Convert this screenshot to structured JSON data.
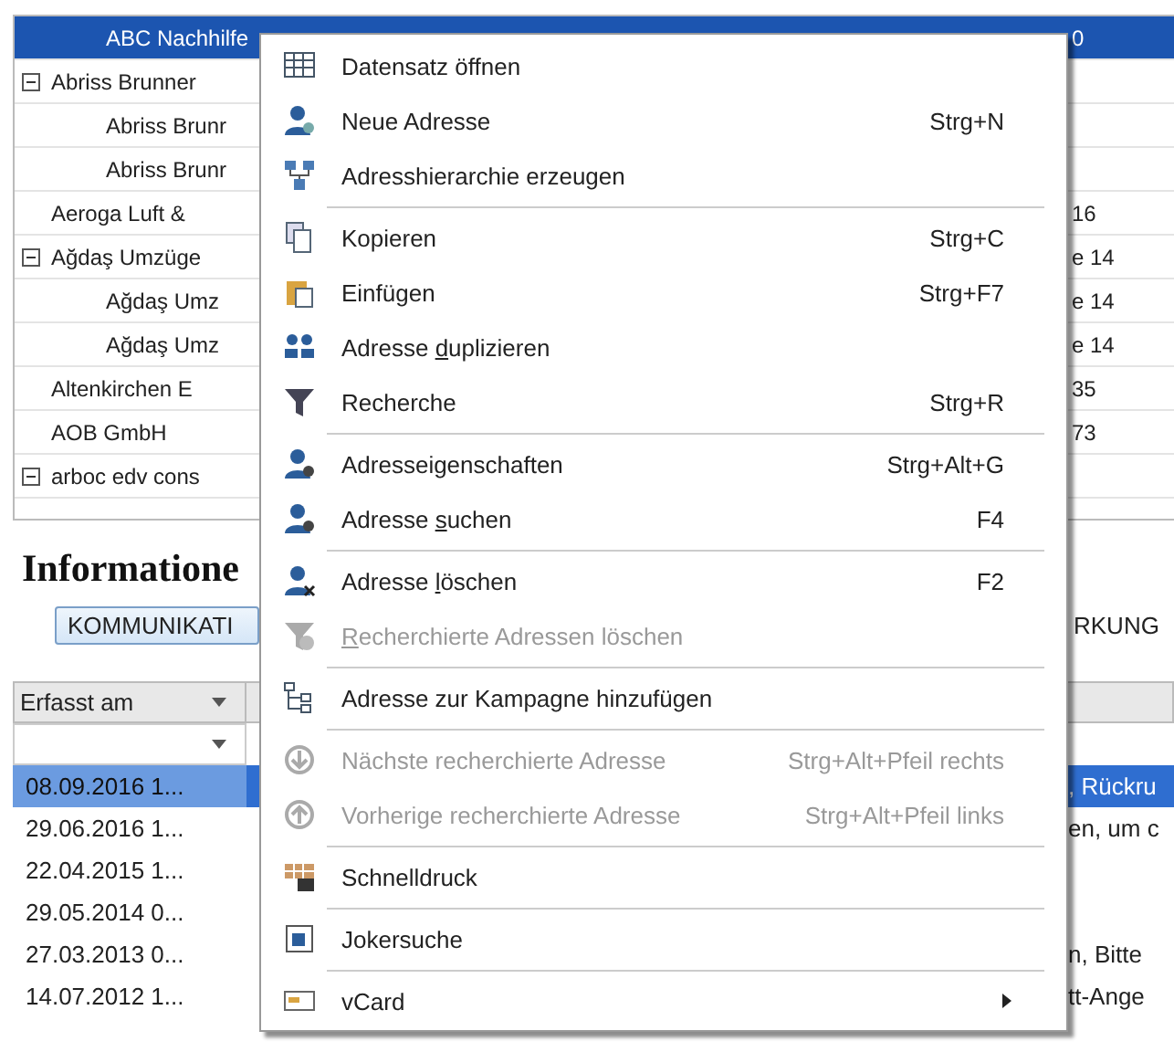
{
  "address_list": {
    "rows": [
      {
        "name": "ABC Nachhilfe",
        "expander": false,
        "indented": true,
        "selected": true,
        "column_2": "0"
      },
      {
        "name": "Abriss Brunner",
        "expander": true,
        "indented": false,
        "selected": false
      },
      {
        "name": "Abriss Brunr",
        "expander": false,
        "indented": true,
        "selected": false
      },
      {
        "name": "Abriss Brunr",
        "expander": false,
        "indented": true,
        "selected": false
      },
      {
        "name": "Aeroga Luft &",
        "expander": false,
        "indented": false,
        "selected": false,
        "column_2": "16"
      },
      {
        "name": "Ağdaş Umzüge",
        "expander": true,
        "indented": false,
        "selected": false,
        "column_2": "e 14"
      },
      {
        "name": "Ağdaş Umz",
        "expander": false,
        "indented": true,
        "selected": false,
        "column_2": "e 14"
      },
      {
        "name": "Ağdaş Umz",
        "expander": false,
        "indented": true,
        "selected": false,
        "column_2": "e 14"
      },
      {
        "name": "Altenkirchen E",
        "expander": false,
        "indented": false,
        "selected": false,
        "column_2": "35"
      },
      {
        "name": "AOB GmbH",
        "expander": false,
        "indented": false,
        "selected": false,
        "column_2": "73"
      },
      {
        "name": "arboc edv cons",
        "expander": true,
        "indented": false,
        "selected": false
      }
    ]
  },
  "information": {
    "title": "Informatione",
    "tabs": [
      {
        "label": "KOMMUNIKATI",
        "selected": true
      },
      {
        "label": "RKUNG",
        "selected": false
      }
    ],
    "grid": {
      "column_header": "Erfasst am",
      "rows": [
        {
          "date": "08.09.2016 1...",
          "column_2": ", Rückru",
          "selected": true
        },
        {
          "date": "29.06.2016 1...",
          "column_2": "en, um c",
          "selected": false
        },
        {
          "date": "22.04.2015 1...",
          "selected": false
        },
        {
          "date": "29.05.2014 0...",
          "selected": false
        },
        {
          "date": "27.03.2013 0...",
          "column_2": "n, Bitte",
          "selected": false
        },
        {
          "date": "14.07.2012 1...",
          "column_2": "tt-Ange",
          "selected": false
        }
      ]
    }
  },
  "context_menu": [
    {
      "kind": "item",
      "label": [
        {
          "text": "Datensatz öffnen",
          "underlined": false
        }
      ],
      "disabled": false,
      "submenu": false
    },
    {
      "kind": "item",
      "label": [
        {
          "text": "Neue Adresse",
          "underlined": false
        }
      ],
      "shortcut": "Strg+N",
      "disabled": false,
      "submenu": false
    },
    {
      "kind": "item",
      "label": [
        {
          "text": "Adresshierarchie erzeugen",
          "underlined": false
        }
      ],
      "disabled": false,
      "submenu": false
    },
    {
      "kind": "separator"
    },
    {
      "kind": "item",
      "label": [
        {
          "text": "Kopieren",
          "underlined": false
        }
      ],
      "shortcut": "Strg+C",
      "disabled": false,
      "submenu": false
    },
    {
      "kind": "item",
      "label": [
        {
          "text": "Einfügen",
          "underlined": false
        }
      ],
      "shortcut": "Strg+F7",
      "disabled": false,
      "submenu": false
    },
    {
      "kind": "item",
      "label": [
        {
          "text": "Adresse ",
          "underlined": false
        },
        {
          "text": "d",
          "underlined": true
        },
        {
          "text": "uplizieren",
          "underlined": false
        }
      ],
      "disabled": false,
      "submenu": false
    },
    {
      "kind": "item",
      "label": [
        {
          "text": "Recherche",
          "underlined": false
        }
      ],
      "shortcut": "Strg+R",
      "disabled": false,
      "submenu": false
    },
    {
      "kind": "separator"
    },
    {
      "kind": "item",
      "label": [
        {
          "text": "Adresseigenschaften",
          "underlined": false
        }
      ],
      "shortcut": "Strg+Alt+G",
      "disabled": false,
      "submenu": false
    },
    {
      "kind": "item",
      "label": [
        {
          "text": "Adresse ",
          "underlined": false
        },
        {
          "text": "s",
          "underlined": true
        },
        {
          "text": "uchen",
          "underlined": false
        }
      ],
      "shortcut": "F4",
      "disabled": false,
      "submenu": false
    },
    {
      "kind": "separator"
    },
    {
      "kind": "item",
      "label": [
        {
          "text": "Adresse ",
          "underlined": false
        },
        {
          "text": "l",
          "underlined": true
        },
        {
          "text": "öschen",
          "underlined": false
        }
      ],
      "shortcut": "F2",
      "disabled": false,
      "submenu": false
    },
    {
      "kind": "item",
      "label": [
        {
          "text": "R",
          "underlined": true
        },
        {
          "text": "echerchierte Adressen löschen",
          "underlined": false
        }
      ],
      "disabled": true,
      "submenu": false
    },
    {
      "kind": "separator"
    },
    {
      "kind": "item",
      "label": [
        {
          "text": "Adresse zur Kampagne hinzufügen",
          "underlined": false
        }
      ],
      "disabled": false,
      "submenu": false
    },
    {
      "kind": "separator"
    },
    {
      "kind": "item",
      "label": [
        {
          "text": "Nächste recherchierte Adresse",
          "underlined": false
        }
      ],
      "shortcut": "Strg+Alt+Pfeil rechts",
      "disabled": true,
      "submenu": false
    },
    {
      "kind": "item",
      "label": [
        {
          "text": "Vorherige recherchierte Adresse",
          "underlined": false
        }
      ],
      "shortcut": "Strg+Alt+Pfeil links",
      "disabled": true,
      "submenu": false
    },
    {
      "kind": "separator"
    },
    {
      "kind": "item",
      "label": [
        {
          "text": "Schnelldruck",
          "underlined": false
        }
      ],
      "disabled": false,
      "submenu": false
    },
    {
      "kind": "separator"
    },
    {
      "kind": "item",
      "label": [
        {
          "text": "Jokersuche",
          "underlined": false
        }
      ],
      "disabled": false,
      "submenu": false
    },
    {
      "kind": "separator"
    },
    {
      "kind": "item",
      "label": [
        {
          "text": "vCard",
          "underlined": false
        }
      ],
      "disabled": false,
      "submenu": true
    }
  ]
}
